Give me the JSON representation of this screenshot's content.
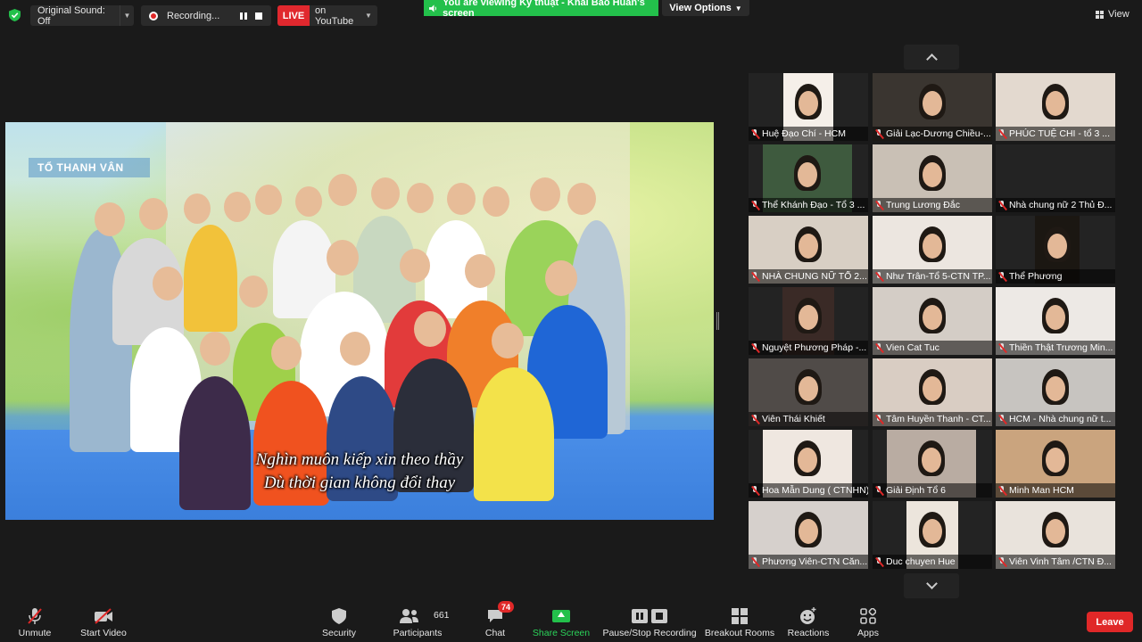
{
  "topbar": {
    "original_sound": "Original Sound: Off",
    "recording": "Recording...",
    "live": "LIVE",
    "youtube": "on YouTube",
    "share_banner": "You are viewing Kỹ thuật - Khải Báo Huấn's screen",
    "view_options": "View Options",
    "view": "View"
  },
  "shared": {
    "channel_tag": "TỔ THANH VÂN",
    "subtitle_line1": "Nghìn muôn kiếp xin theo thầy",
    "subtitle_line2": "Dù thời gian không đổi thay"
  },
  "participants": [
    {
      "name": "Huệ Đạo Chí - HCM"
    },
    {
      "name": "Giải Lạc-Dương Chiều-..."
    },
    {
      "name": "PHÚC TUỆ CHI  - tổ 3 ..."
    },
    {
      "name": "Thể Khánh Đạo - Tổ 3 ..."
    },
    {
      "name": "Trung Lương Đắc"
    },
    {
      "name": "Nhà chung nữ 2 Thủ Đ..."
    },
    {
      "name": "NHÀ CHUNG NỮ TỔ 2..."
    },
    {
      "name": "Như Trân-Tổ 5-CTN TP..."
    },
    {
      "name": "Thể Phương"
    },
    {
      "name": "Nguyệt Phương Pháp -..."
    },
    {
      "name": "Vien Cat Tuc"
    },
    {
      "name": "Thiền Thật Trương Min..."
    },
    {
      "name": "Viên Thái Khiết"
    },
    {
      "name": "Tâm Huyền Thanh - CT..."
    },
    {
      "name": "HCM - Nhà chung nữ t..."
    },
    {
      "name": "Hoa Mẫn Dung ( CTNHN)"
    },
    {
      "name": "Giải Định Tổ 6"
    },
    {
      "name": "Minh Man HCM"
    },
    {
      "name": "Phương Viên-CTN Căn..."
    },
    {
      "name": "Duc chuyen Hue"
    },
    {
      "name": "Viên Vinh Tâm /CTN Đ..."
    }
  ],
  "toolbar": {
    "unmute": "Unmute",
    "start_video": "Start Video",
    "security": "Security",
    "participants": "Participants",
    "participant_count": "661",
    "chat": "Chat",
    "chat_badge": "74",
    "share_screen": "Share Screen",
    "pause_recording": "Pause/Stop Recording",
    "breakout_rooms": "Breakout Rooms",
    "reactions": "Reactions",
    "apps": "Apps",
    "leave": "Leave"
  },
  "colors": {
    "share_green": "#23c04b",
    "live_red": "#e0282e",
    "leave_red": "#e02828",
    "background": "#1a1a1a"
  }
}
